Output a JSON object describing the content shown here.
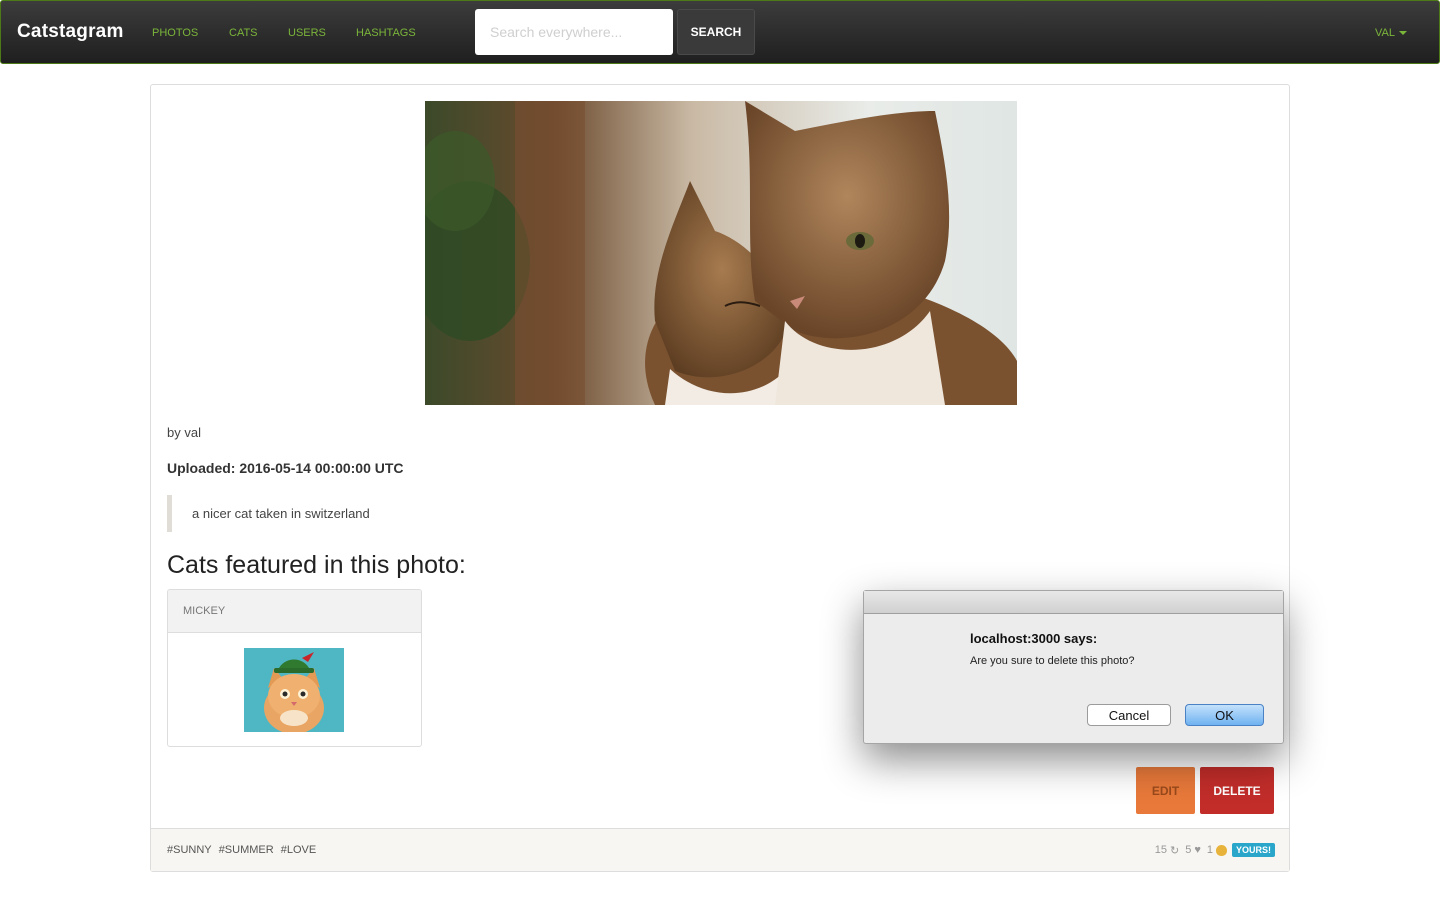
{
  "navbar": {
    "brand": "Catstagram",
    "links": [
      "PHOTOS",
      "CATS",
      "USERS",
      "HASHTAGS"
    ],
    "search_placeholder": "Search everywhere...",
    "search_button": "SEARCH",
    "user_menu": "VAL"
  },
  "photo": {
    "byline": "by val",
    "uploaded": "Uploaded: 2016-05-14 00:00:00 UTC",
    "caption": "a nicer cat taken in switzerland",
    "cats_heading": "Cats featured in this photo:",
    "featured_cat": {
      "name": "MICKEY"
    },
    "edit_label": "EDIT",
    "delete_label": "DELETE"
  },
  "footer": {
    "hashtags": [
      "#SUNNY",
      "#SUMMER",
      "#LOVE"
    ],
    "views": "15",
    "reposts": "5",
    "likes": "1",
    "badge": "YOURS!"
  },
  "dialog": {
    "title": "localhost:3000 says:",
    "message": "Are you sure to delete this photo?",
    "cancel_label": "Cancel",
    "ok_label": "OK"
  }
}
